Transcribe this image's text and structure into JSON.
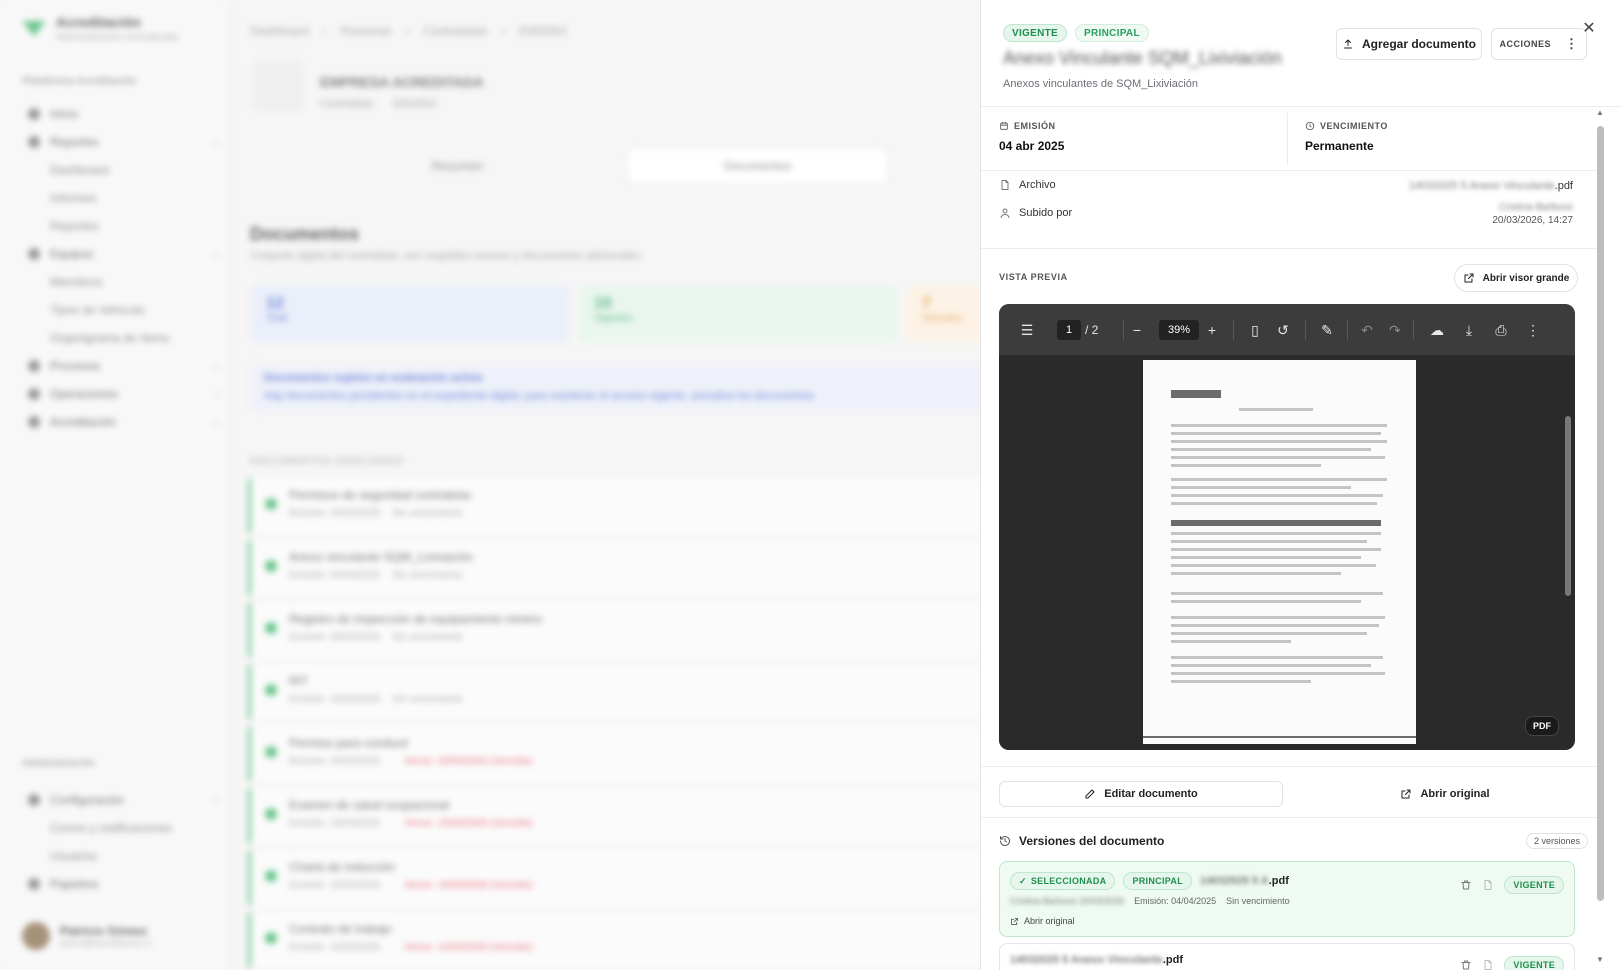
{
  "background": {
    "brand": {
      "title": "Acreditación",
      "subtitle": "Administración centralizada"
    },
    "sidebar_section": "Plataforma Acreditación",
    "sidebar_items": [
      {
        "label": "Inicio"
      },
      {
        "label": "Reportes"
      },
      {
        "label": "Dashboard"
      },
      {
        "label": "Informes"
      },
      {
        "label": "Reportes"
      },
      {
        "label": "Equipos"
      },
      {
        "label": "Miembros"
      },
      {
        "label": "Tipos de Vehículo"
      },
      {
        "label": "Organigrama de ítems"
      },
      {
        "label": "Procesos"
      },
      {
        "label": "Operaciones"
      },
      {
        "label": "Acreditación"
      }
    ],
    "admin_section": "Administración",
    "admin_items": [
      {
        "label": "Configuración"
      },
      {
        "label": "Correo y notificaciones"
      },
      {
        "label": "Usuarios"
      },
      {
        "label": "Papelera"
      }
    ],
    "user": {
      "name": "Patricio Gómez",
      "email": "admin@acreditacion.cl"
    },
    "breadcrumb": [
      "Dashboard",
      "Personas",
      "Contratistas",
      "E002001"
    ],
    "entity": {
      "title": "EMPRESA ACREDITADA",
      "meta_a": "Contratista",
      "meta_b": "E002001"
    },
    "tabs": [
      "Resumen",
      "Documentos"
    ],
    "docs_title": "Documentos",
    "docs_subtitle": "Conjunto digital del contratista, con respaldos anexos y documentos adicionales",
    "stats": [
      {
        "value": "12",
        "label": "Total"
      },
      {
        "value": "10",
        "label": "Vigentes"
      },
      {
        "value": "7",
        "label": "Vencidos"
      }
    ],
    "alert_title": "Documentos sujetos en evaluación activa",
    "alert_text": "Hay documentos pendientes en el expediente digital, para mantener el acceso vigente, actualice los documentos",
    "list_header": "DOCUMENTOS ASOCIADOS",
    "doc_rows": [
      {
        "title": "Permisos de seguridad contratista",
        "meta": "Emisión: 20/03/2025",
        "status": "Sin vencimiento",
        "warn": ""
      },
      {
        "title": "Anexo vinculante SQM_Lixiviación",
        "meta": "Emisión: 04/04/2025",
        "status": "Sin vencimiento",
        "warn": ""
      },
      {
        "title": "Registro de inspección de equipamiento minero",
        "meta": "Emisión: 20/03/2025",
        "status": "Sin vencimiento",
        "warn": ""
      },
      {
        "title": "RIT",
        "meta": "Emisión: 10/03/2025",
        "status": "Sin vencimiento",
        "warn": ""
      },
      {
        "title": "Permiso para conducir",
        "meta": "Emisión: 20/03/2025",
        "status": "",
        "warn": "Vence: 20/03/2026 (Vencido)"
      },
      {
        "title": "Examen de salud ocupacional",
        "meta": "Emisión: 15/03/2025",
        "status": "",
        "warn": "Vence: 15/03/2026 (Vencido)"
      },
      {
        "title": "Charla de inducción",
        "meta": "Emisión: 15/03/2025",
        "status": "",
        "warn": "Vence: 15/03/2026 (Vencido)"
      },
      {
        "title": "Contrato de trabajo",
        "meta": "Emisión: 10/03/2025",
        "status": "",
        "warn": "Vence: 10/03/2026 (Vencido)"
      }
    ]
  },
  "drawer": {
    "badges": [
      "VIGENTE",
      "PRINCIPAL"
    ],
    "title": "Anexo Vinculante SQM_Lixiviación",
    "subtitle": "Anexos vinculantes de SQM_Lixiviación",
    "add_button": "Agregar documento",
    "actions_button": "ACCIONES",
    "emission_label": "EMISIÓN",
    "emission_value": "04 abr 2025",
    "expiry_label": "VENCIMIENTO",
    "expiry_value": "Permanente",
    "file_label": "Archivo",
    "file_name": "14032025 5 Anexo Vinculante",
    "file_ext": ".pdf",
    "uploaded_label": "Subido por",
    "uploaded_by": "Cristina Barbuce",
    "uploaded_at": "20/03/2026, 14:27",
    "preview_label": "VISTA PREVIA",
    "open_viewer_button": "Abrir visor grande",
    "pdf": {
      "page": "1",
      "pages_text": "/  2",
      "zoom": "39%",
      "tag": "PDF"
    },
    "edit_button": "Editar documento",
    "open_original_button": "Abrir original",
    "versions_title": "Versiones del documento",
    "versions_count": "2 versiones",
    "versions": [
      {
        "badges": [
          "SELECCIONADA",
          "PRINCIPAL"
        ],
        "file_blurred": "14032025 5 A",
        "file_ext": ".pdf",
        "uploader": "Cristina Barbuce 20/03/2026",
        "emission": "Emisión: 04/04/2025",
        "expiry": "Sin vencimiento",
        "link": "Abrir original",
        "status": "VIGENTE"
      },
      {
        "file_blurred": "14032025 5 Anexo Vinculante",
        "file_ext": ".pdf",
        "status": "VIGENTE"
      }
    ]
  },
  "colors": {
    "accent_green": "#1f8f4e",
    "danger": "#e0384b",
    "pdf_toolbar": "#3c3c3c"
  }
}
